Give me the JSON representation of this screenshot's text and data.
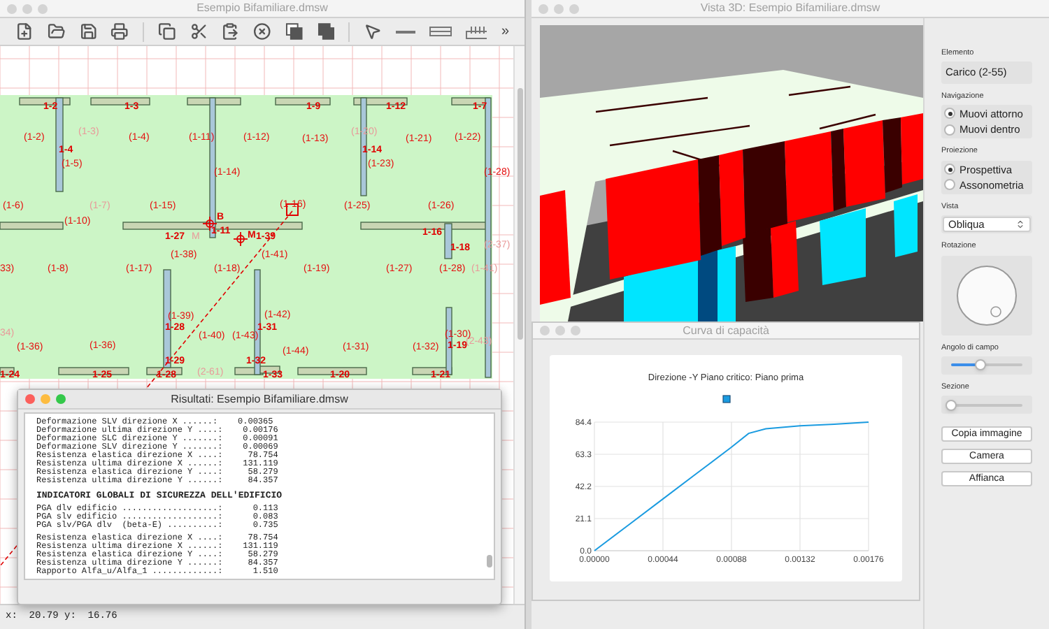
{
  "plan_window": {
    "title": "Esempio Bifamiliare.dmsw",
    "focused": false,
    "toolbar_more": "»",
    "labels": [
      {
        "text": "1-2",
        "kind": "element"
      },
      {
        "text": "1-3",
        "kind": "element"
      },
      {
        "text": "1-9",
        "kind": "element"
      },
      {
        "text": "1-12",
        "kind": "element"
      },
      {
        "text": "1-7",
        "kind": "element"
      },
      {
        "text": "(1-2)",
        "kind": "region"
      },
      {
        "text": "(1-3)",
        "kind": "ghost"
      },
      {
        "text": "(1-4)",
        "kind": "region"
      },
      {
        "text": "(1-11)",
        "kind": "region"
      },
      {
        "text": "(1-12)",
        "kind": "region"
      },
      {
        "text": "(1-13)",
        "kind": "region"
      },
      {
        "text": "(1-20)",
        "kind": "ghost"
      },
      {
        "text": "(1-21)",
        "kind": "region"
      },
      {
        "text": "(1-22)",
        "kind": "region"
      },
      {
        "text": "1-4",
        "kind": "element"
      },
      {
        "text": "(1-5)",
        "kind": "region"
      },
      {
        "text": "1-14",
        "kind": "element"
      },
      {
        "text": "(1-23)",
        "kind": "region"
      },
      {
        "text": "(1-14)",
        "kind": "region"
      },
      {
        "text": "(1-28)",
        "kind": "region"
      },
      {
        "text": "(1-6)",
        "kind": "region"
      },
      {
        "text": "(1-7)",
        "kind": "ghost"
      },
      {
        "text": "(1-15)",
        "kind": "region"
      },
      {
        "text": "(1-16)",
        "kind": "region"
      },
      {
        "text": "(1-25)",
        "kind": "region"
      },
      {
        "text": "(1-26)",
        "kind": "region"
      },
      {
        "text": "(1-10)",
        "kind": "region"
      },
      {
        "text": "B",
        "kind": "element"
      },
      {
        "text": "1-27",
        "kind": "element"
      },
      {
        "text": "M",
        "kind": "ghost"
      },
      {
        "text": "1-11",
        "kind": "element"
      },
      {
        "text": "M",
        "kind": "element"
      },
      {
        "text": "1-39",
        "kind": "element"
      },
      {
        "text": "1-16",
        "kind": "element"
      },
      {
        "text": "1-18",
        "kind": "element"
      },
      {
        "text": "(2-37)",
        "kind": "ghost"
      },
      {
        "text": "(1-38)",
        "kind": "region"
      },
      {
        "text": "(1-41)",
        "kind": "region"
      },
      {
        "text": "33)",
        "kind": "region"
      },
      {
        "text": "(1-8)",
        "kind": "region"
      },
      {
        "text": "(1-17)",
        "kind": "region"
      },
      {
        "text": "(1-18)",
        "kind": "region"
      },
      {
        "text": "(1-19)",
        "kind": "region"
      },
      {
        "text": "(1-27)",
        "kind": "region"
      },
      {
        "text": "(1-28)",
        "kind": "region"
      },
      {
        "text": "(1-41)",
        "kind": "ghost"
      },
      {
        "text": "(1-39)",
        "kind": "region"
      },
      {
        "text": "(1-42)",
        "kind": "region"
      },
      {
        "text": "1-28",
        "kind": "element"
      },
      {
        "text": "1-31",
        "kind": "element"
      },
      {
        "text": "34)",
        "kind": "ghost"
      },
      {
        "text": "(1-40)",
        "kind": "region"
      },
      {
        "text": "(1-43)",
        "kind": "region"
      },
      {
        "text": "(1-30)",
        "kind": "region"
      },
      {
        "text": "1-19",
        "kind": "element"
      },
      {
        "text": "(2-43)",
        "kind": "ghost"
      },
      {
        "text": "(1-36)",
        "kind": "region"
      },
      {
        "text": "(1-36)",
        "kind": "region"
      },
      {
        "text": "(1-44)",
        "kind": "region"
      },
      {
        "text": "(1-31)",
        "kind": "region"
      },
      {
        "text": "(1-32)",
        "kind": "region"
      },
      {
        "text": "1-29",
        "kind": "element"
      },
      {
        "text": "1-32",
        "kind": "element"
      },
      {
        "text": "1-24",
        "kind": "element"
      },
      {
        "text": "1-25",
        "kind": "element"
      },
      {
        "text": "1-28",
        "kind": "element"
      },
      {
        "text": "(2-61)",
        "kind": "ghost"
      },
      {
        "text": "1-33",
        "kind": "element"
      },
      {
        "text": "1-20",
        "kind": "element"
      },
      {
        "text": "1-21",
        "kind": "element"
      }
    ],
    "status_bar": "x:  20.79 y:  16.76"
  },
  "results_window": {
    "title": "Risultati: Esempio Bifamiliare.dmsw",
    "focused": true,
    "block_1": [
      "Deformazione SLV direzione X ......:    0.00365",
      "Deformazione ultima direzione Y ....:    0.00176",
      "Deformazione SLC direzione Y .......:    0.00091",
      "Deformazione SLV direzione Y .......:    0.00069",
      "Resistenza elastica direzione X ....:     78.754",
      "Resistenza ultima direzione X ......:    131.119",
      "Resistenza elastica direzione Y ....:     58.279",
      "Resistenza ultima direzione Y ......:     84.357"
    ],
    "heading": "INDICATORI GLOBALI DI SICUREZZA DELL'EDIFICIO",
    "block_2": [
      "PGA dlv edificio ...................:      0.113",
      "PGA slv edificio ...................:      0.083",
      "PGA slv/PGA dlv  (beta-E) ..........:      0.735"
    ],
    "block_3": [
      "Resistenza elastica direzione X ....:     78.754",
      "Resistenza ultima direzione X ......:    131.119",
      "Resistenza elastica direzione Y ....:     58.279",
      "Resistenza ultima direzione Y ......:     84.357",
      "Rapporto Alfa_u/Alfa_1 .............:      1.510"
    ]
  },
  "view_window": {
    "title": "Vista 3D: Esempio Bifamiliare.dmsw",
    "focused": false
  },
  "curve_window": {
    "title": "Curva di capacità",
    "focused": false,
    "chart_data": {
      "type": "line",
      "title": "Direzione -Y Piano critico: Piano prima",
      "x": [
        0,
        0.00022,
        0.00044,
        0.00066,
        0.00088,
        0.00099,
        0.0011,
        0.00132,
        0.00154,
        0.00176
      ],
      "series": [
        {
          "color": "#1a9be0",
          "values": [
            0,
            17,
            34,
            51,
            68,
            77,
            80,
            82,
            83,
            84.4
          ]
        }
      ],
      "grid": true,
      "xlim": [
        0,
        0.00176
      ],
      "ylim": [
        0,
        84.4
      ],
      "xticks": [
        {
          "value": 0,
          "label": "0.00000"
        },
        {
          "value": 0.00044,
          "label": "0.00044"
        },
        {
          "value": 0.00088,
          "label": "0.00088"
        },
        {
          "value": 0.00132,
          "label": "0.00132"
        },
        {
          "value": 0.00176,
          "label": "0.00176"
        }
      ],
      "yticks": [
        {
          "value": 0,
          "label": "0.0"
        },
        {
          "value": 21.1,
          "label": "21.1"
        },
        {
          "value": 42.2,
          "label": "42.2"
        },
        {
          "value": 63.3,
          "label": "63.3"
        },
        {
          "value": 84.4,
          "label": "84.4"
        }
      ]
    }
  },
  "side_panel": {
    "element_label": "Elemento",
    "element_value": "Carico (2-55)",
    "navigation": {
      "label": "Navigazione",
      "options": [
        {
          "label": "Muovi attorno",
          "selected": true
        },
        {
          "label": "Muovi dentro",
          "selected": false
        }
      ]
    },
    "projection": {
      "label": "Proiezione",
      "options": [
        {
          "label": "Prospettiva",
          "selected": true
        },
        {
          "label": "Assonometria",
          "selected": false
        }
      ]
    },
    "view": {
      "label": "Vista",
      "value": "Obliqua"
    },
    "rotation_label": "Rotazione",
    "sliders": [
      {
        "label": "Angolo di campo",
        "level": 0.42
      },
      {
        "label": "Sezione",
        "level": 0
      }
    ],
    "buttons": [
      "Copia immagine",
      "Camera",
      "Affianca"
    ]
  }
}
